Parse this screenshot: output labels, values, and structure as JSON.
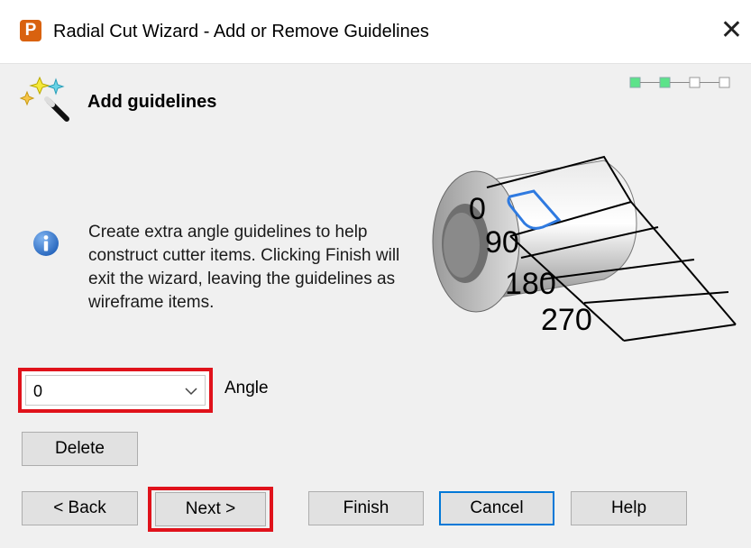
{
  "window": {
    "title": "Radial Cut Wizard - Add or Remove Guidelines",
    "app_icon_letter": "P",
    "close_glyph": "✕"
  },
  "header": {
    "title": "Add guidelines",
    "icon": "wizard-wand-icon",
    "progress": {
      "total_steps": 4,
      "completed_steps": 2,
      "color_done": "#5ce38a"
    }
  },
  "illustration": {
    "angle_labels": [
      "0",
      "90",
      "180",
      "270"
    ],
    "highlight_color": "#2f7ae0"
  },
  "info": {
    "icon": "info-icon",
    "text": "Create extra angle guidelines to help construct cutter items. Clicking Finish will exit the wizard, leaving the guidelines as wireframe items."
  },
  "angle": {
    "value": "0",
    "label": "Angle",
    "highlight_color": "#e0121b"
  },
  "buttons": {
    "delete": "Delete",
    "back": "< Back",
    "next": "Next >",
    "finish": "Finish",
    "cancel": "Cancel",
    "help": "Help"
  }
}
